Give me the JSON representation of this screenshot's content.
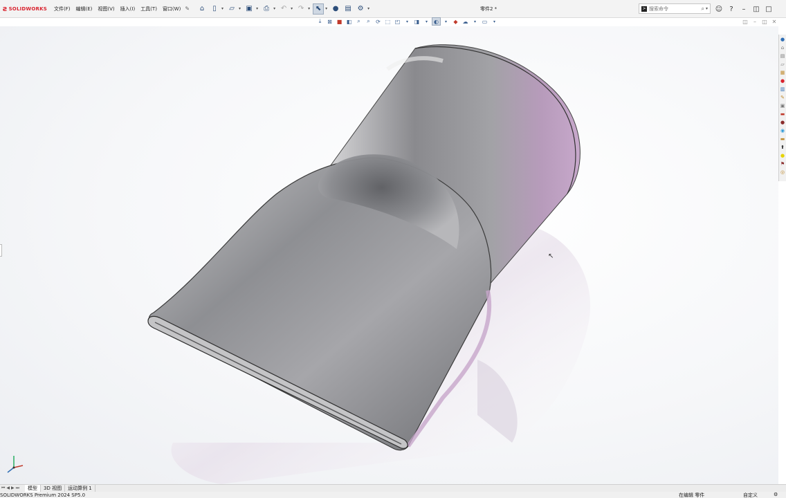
{
  "app": {
    "logo_text": "SOLIDWORKS",
    "document_title": "零件2 *"
  },
  "menu": {
    "items": [
      {
        "label": "文件(F)"
      },
      {
        "label": "编辑(E)"
      },
      {
        "label": "视图(V)"
      },
      {
        "label": "插入(I)"
      },
      {
        "label": "工具(T)"
      },
      {
        "label": "窗口(W)"
      }
    ]
  },
  "search": {
    "placeholder": "搜索命令"
  },
  "tabs": [
    {
      "label": "模型",
      "active": true
    },
    {
      "label": "3D 视图",
      "active": false
    },
    {
      "label": "运动算例 1",
      "active": false
    }
  ],
  "status": {
    "product": "SOLIDWORKS Premium 2024 SP5.0",
    "editing": "在编辑 零件",
    "custom": "自定义"
  },
  "colors": {
    "brand": "#d9232e",
    "selected_tool": "#cfd8e3"
  },
  "icons": {
    "quick_access": [
      "home-icon",
      "new-icon",
      "open-icon",
      "save-icon",
      "print-icon",
      "undo-icon",
      "redo-icon",
      "select-icon",
      "rebuild-icon",
      "file-properties-icon",
      "options-icon"
    ],
    "heads_up": [
      "zoom-to-fit-icon",
      "zoom-area-icon",
      "previous-view-icon",
      "section-view-icon",
      "dynamic-annotation-icon",
      "view-orientation-icon",
      "display-style-icon",
      "hide-show-icon",
      "edit-appearance-icon",
      "apply-scene-icon",
      "view-settings-icon"
    ],
    "task_pane": [
      "solidworks-resources-icon",
      "design-library-icon",
      "file-explorer-icon",
      "view-palette-icon",
      "appearances-icon",
      "custom-properties-icon"
    ]
  }
}
